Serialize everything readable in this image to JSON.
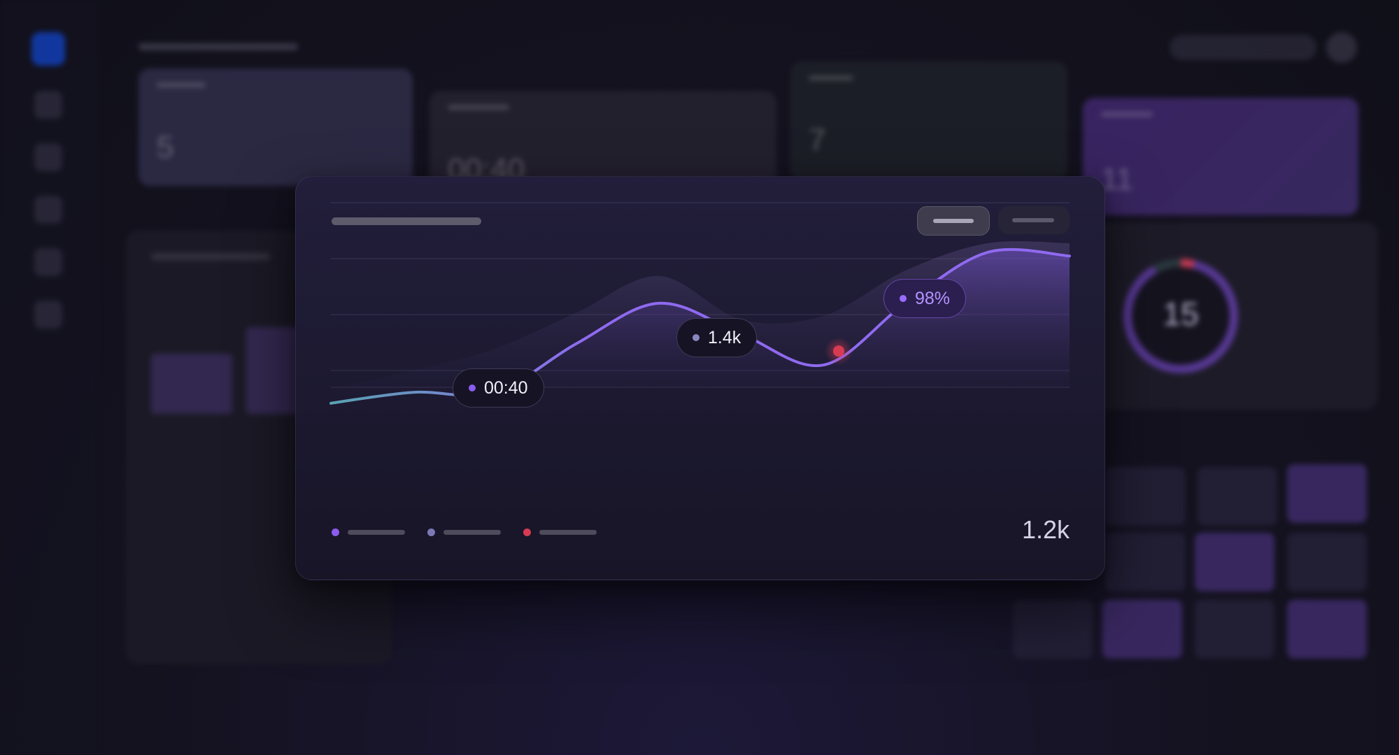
{
  "background": {
    "stats": [
      {
        "value": "5"
      },
      {
        "value": "00:40"
      },
      {
        "value": "7"
      },
      {
        "value": "11"
      }
    ],
    "donut": {
      "value": "15",
      "fraction": 0.92,
      "ring_color": "#5b3a9a",
      "alert_color": "#c43a55"
    }
  },
  "main_card": {
    "tooltips": {
      "time": {
        "label": "00:40",
        "dot_color": "#8a5cf0"
      },
      "count": {
        "label": "1.4k",
        "dot_color": "#8a86c0"
      },
      "percent": {
        "label": "98%",
        "dot_color": "#9a6bff"
      }
    },
    "legend": [
      {
        "color": "#8a5cf0"
      },
      {
        "color": "#7c78b8"
      },
      {
        "color": "#d63b52"
      }
    ],
    "total": "1.2k"
  },
  "chart_data": {
    "type": "line",
    "series": [
      {
        "values": [
          0.12,
          0.18,
          0.18,
          0.45,
          0.67,
          0.5,
          0.33,
          0.67,
          0.95,
          0.93
        ]
      },
      {
        "values": [
          0.2,
          0.3,
          0.42,
          0.62,
          0.82,
          0.58,
          0.6,
          0.85,
          1.0,
          1.0
        ]
      }
    ],
    "marker": {
      "index": 6,
      "color": "#d63b52"
    },
    "line_color_start": "#5aa2b0",
    "line_color_end": "#8f6af0",
    "grid": true
  }
}
